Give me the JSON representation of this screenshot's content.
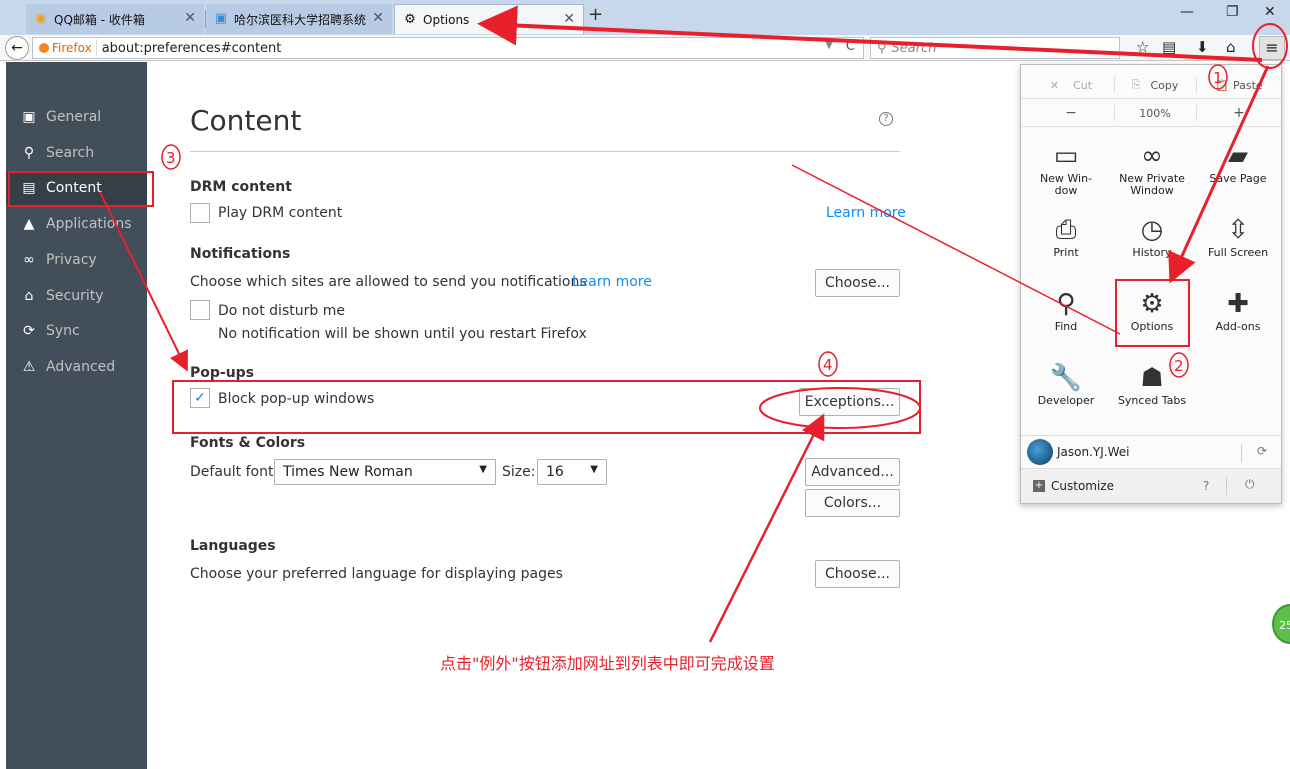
{
  "tabs": [
    {
      "label": "QQ邮箱 - 收件箱",
      "icon": "qq-mail-icon"
    },
    {
      "label": "哈尔滨医科大学招聘系统",
      "icon": "site-icon"
    },
    {
      "label": "Options",
      "icon": "gear-icon"
    }
  ],
  "nav": {
    "identity": "Firefox",
    "url": "about:preferences#content",
    "search_placeholder": "Search"
  },
  "sidebar": {
    "items": [
      {
        "label": "General",
        "icon": "general-icon"
      },
      {
        "label": "Search",
        "icon": "search-icon"
      },
      {
        "label": "Content",
        "icon": "content-icon",
        "selected": true
      },
      {
        "label": "Applications",
        "icon": "applications-icon"
      },
      {
        "label": "Privacy",
        "icon": "privacy-icon"
      },
      {
        "label": "Security",
        "icon": "security-icon"
      },
      {
        "label": "Sync",
        "icon": "sync-icon"
      },
      {
        "label": "Advanced",
        "icon": "advanced-icon"
      }
    ]
  },
  "content": {
    "title": "Content",
    "drm": {
      "heading": "DRM content",
      "checkbox_label": "Play DRM content",
      "learn_more": "Learn more"
    },
    "notifications": {
      "heading": "Notifications",
      "desc": "Choose which sites are allowed to send you notifications",
      "learn_more": "Learn more",
      "choose": "Choose...",
      "dnd_label": "Do not disturb me",
      "dnd_note": "No notification will be shown until you restart Firefox"
    },
    "popups": {
      "heading": "Pop-ups",
      "checkbox_label": "Block pop-up windows",
      "exceptions": "Exceptions..."
    },
    "fonts": {
      "heading": "Fonts & Colors",
      "default_font_label": "Default font:",
      "default_font_value": "Times New Roman",
      "size_label": "Size:",
      "size_value": "16",
      "advanced": "Advanced...",
      "colors": "Colors..."
    },
    "languages": {
      "heading": "Languages",
      "desc": "Choose your preferred language for displaying pages",
      "choose": "Choose..."
    }
  },
  "panel": {
    "cut": "Cut",
    "copy": "Copy",
    "paste": "Paste",
    "zoom_out": "−",
    "zoom": "100%",
    "zoom_in": "+",
    "items": [
      {
        "label": "New Win-\ndow",
        "icon": "new-window-icon"
      },
      {
        "label": "New Private\nWindow",
        "icon": "private-window-icon"
      },
      {
        "label": "Save Page",
        "icon": "save-page-icon"
      },
      {
        "label": "Print",
        "icon": "print-icon"
      },
      {
        "label": "History",
        "icon": "history-icon"
      },
      {
        "label": "Full Screen",
        "icon": "fullscreen-icon"
      },
      {
        "label": "Find",
        "icon": "find-icon"
      },
      {
        "label": "Options",
        "icon": "options-icon"
      },
      {
        "label": "Add-ons",
        "icon": "addons-icon"
      },
      {
        "label": "Developer",
        "icon": "developer-icon"
      },
      {
        "label": "Synced Tabs",
        "icon": "synced-tabs-icon"
      }
    ],
    "user": "Jason.YJ.Wei",
    "customize": "Customize"
  },
  "annotations": {
    "markers": [
      "1",
      "2",
      "3",
      "4"
    ],
    "caption": "点击\"例外\"按钮添加网址到列表中即可完成设置",
    "badge": "25",
    "color": "#e8202b"
  }
}
